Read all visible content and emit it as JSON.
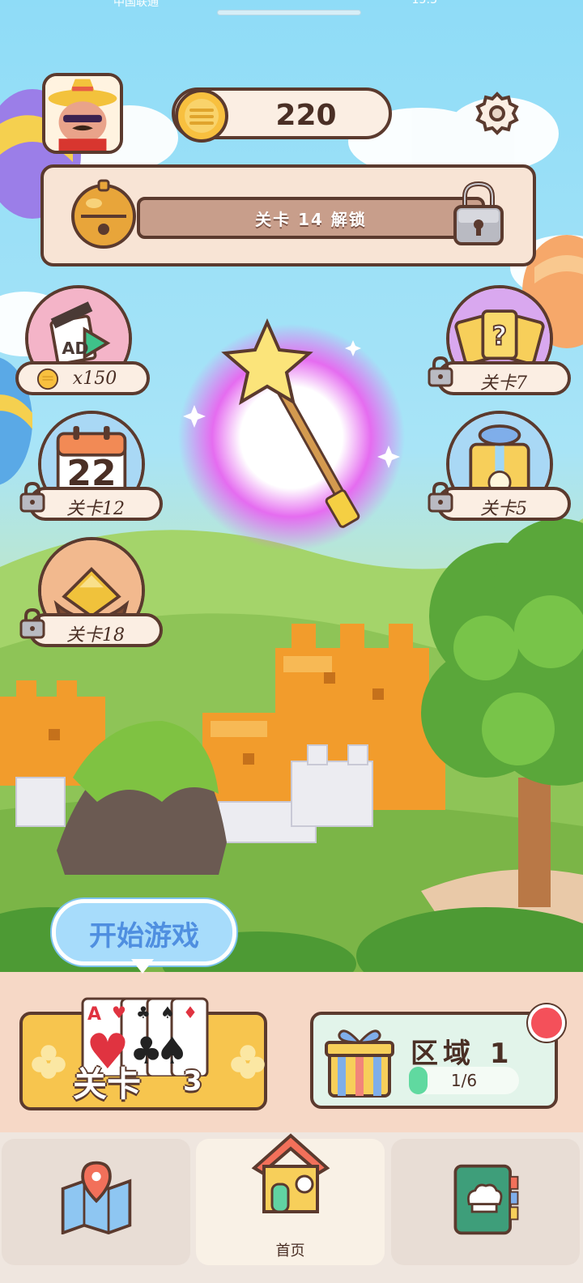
{
  "status_bar": {
    "carrier": "中国联通",
    "time": "15:3"
  },
  "header": {
    "coins": "220"
  },
  "bell_panel": {
    "unlock_text": "关卡 14 解锁"
  },
  "features_left": [
    {
      "label": "x150",
      "icon": "ad-video-icon",
      "locked": false
    },
    {
      "label": "关卡12",
      "icon": "calendar-icon",
      "calendar_day": "22",
      "locked": true
    },
    {
      "label": "关卡18",
      "icon": "golden-nest-icon",
      "locked": true
    }
  ],
  "features_right": [
    {
      "label": "关卡7",
      "icon": "mystery-cards-icon",
      "locked": true
    },
    {
      "label": "关卡5",
      "icon": "gift-box-icon",
      "locked": true
    }
  ],
  "start_button": {
    "label": "开始游戏"
  },
  "level_button": {
    "label": "关卡",
    "number": "3"
  },
  "region_card": {
    "title": "区域 1",
    "progress_text": "1/6",
    "progress_fraction": 0.1667
  },
  "bottom_nav": {
    "items": [
      {
        "icon": "map-icon",
        "label": ""
      },
      {
        "icon": "house-icon",
        "label": "首页"
      },
      {
        "icon": "cookbook-icon",
        "label": ""
      }
    ]
  },
  "colors": {
    "outline": "#5b3a2e",
    "panel": "#fbeee3",
    "gold": "#f7c54e",
    "accent_blue": "#4f8fe0",
    "progress_green": "#60d9a0",
    "badge_red": "#f4505a"
  }
}
